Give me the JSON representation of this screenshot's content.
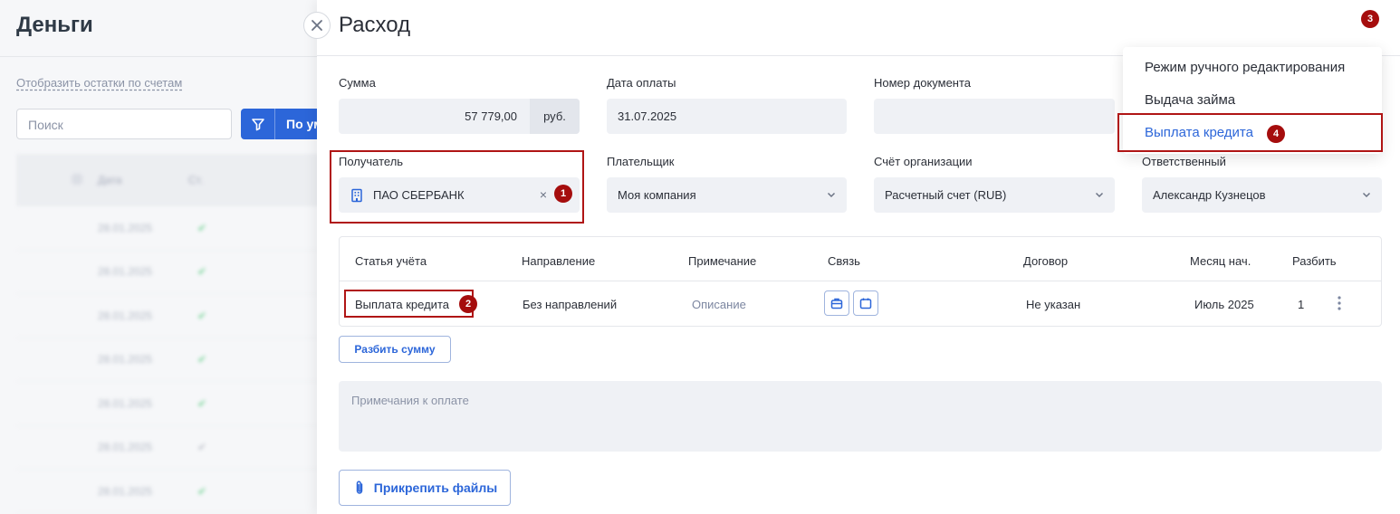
{
  "background": {
    "title": "Деньги",
    "balances_link": "Отобразить остатки по счетам",
    "search_placeholder": "Поиск",
    "filter_button": "По ум",
    "table_header": [
      "Дата",
      "Ст."
    ],
    "rows": [
      "28.01.2025",
      "28.01.2025",
      "28.01.2025",
      "28.01.2025",
      "28.01.2025",
      "28.01.2025",
      "28.01.2025"
    ]
  },
  "panel": {
    "title": "Расход",
    "fields": {
      "amount_label": "Сумма",
      "amount_value": "57 779,00",
      "currency": "руб.",
      "payment_date_label": "Дата оплаты",
      "payment_date_value": "31.07.2025",
      "doc_number_label": "Номер документа",
      "recipient_label": "Получатель",
      "recipient_value": "ПАО СБЕРБАНК",
      "payer_label": "Плательщик",
      "payer_value": "Моя компания",
      "account_label": "Счёт организации",
      "account_value": "Расчетный счет (RUB)",
      "responsible_label": "Ответственный",
      "responsible_value": "Александр Кузнецов"
    },
    "table": {
      "headers": [
        "Статья учёта",
        "Направление",
        "Примечание",
        "Связь",
        "Договор",
        "Месяц нач.",
        "Разбить"
      ],
      "row": {
        "article": "Выплата кредита",
        "direction": "Без направлений",
        "note": "Описание",
        "contract": "Не указан",
        "month": "Июль 2025",
        "split": "1"
      }
    },
    "split_button": "Разбить сумму",
    "notes_placeholder": "Примечания к оплате",
    "attach_button": "Прикрепить файлы"
  },
  "menu": {
    "items": [
      "Режим ручного редактирования",
      "Выдача займа",
      "Выплата кредита"
    ]
  },
  "badges": [
    "1",
    "2",
    "3",
    "4"
  ],
  "colors": {
    "accent": "#2c66d9",
    "highlight": "#b01515",
    "field_bg": "#eff1f5"
  }
}
